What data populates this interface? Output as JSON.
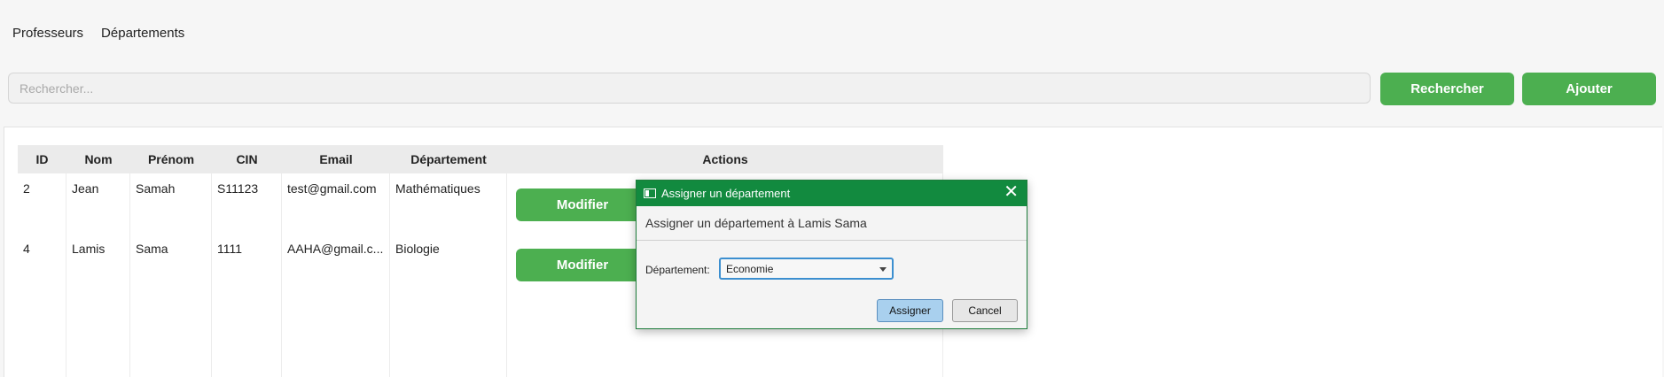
{
  "menu": {
    "items": [
      {
        "label": "Professeurs"
      },
      {
        "label": "Départements"
      }
    ]
  },
  "search": {
    "placeholder": "Rechercher...",
    "value": "",
    "search_button": "Rechercher",
    "add_button": "Ajouter"
  },
  "table": {
    "headers": {
      "id": "ID",
      "nom": "Nom",
      "prenom": "Prénom",
      "cin": "CIN",
      "email": "Email",
      "departement": "Département",
      "actions": "Actions"
    },
    "rows": [
      {
        "id": "2",
        "nom": "Jean",
        "prenom": "Samah",
        "cin": "S11123",
        "email": "test@gmail.com",
        "departement": "Mathématiques",
        "action_label": "Modifier"
      },
      {
        "id": "4",
        "nom": "Lamis",
        "prenom": "Sama",
        "cin": "1111",
        "email": "AAHA@gmail.c...",
        "departement": "Biologie",
        "action_label": "Modifier"
      }
    ]
  },
  "dialog": {
    "title": "Assigner un département",
    "header": "Assigner un département à Lamis Sama",
    "field_label": "Département:",
    "selected_value": "Economie",
    "assign_button": "Assigner",
    "cancel_button": "Cancel",
    "close_symbol": "✕"
  },
  "colors": {
    "accent_green": "#4caf50",
    "dialog_title_green": "#128a3f",
    "focus_blue": "#3c8fd0"
  }
}
